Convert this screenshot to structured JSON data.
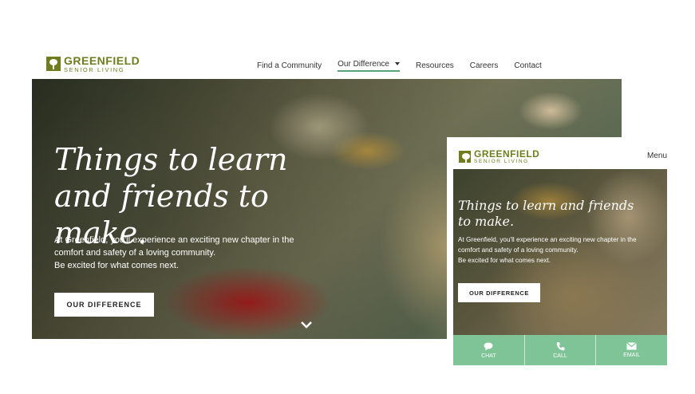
{
  "brand": {
    "name": "GREENFIELD",
    "tagline": "SENIOR LIVING",
    "color": "#6f7d1e"
  },
  "desktop": {
    "nav": [
      {
        "label": "Find a Community"
      },
      {
        "label": "Our Difference",
        "active": true,
        "has_dropdown": true
      },
      {
        "label": "Resources"
      },
      {
        "label": "Careers"
      },
      {
        "label": "Contact"
      }
    ],
    "hero": {
      "title": "Things to learn and friends to make.",
      "body_lines": [
        "At Greenfield, you'll experience an exciting new chapter in the",
        "comfort and safety of a loving community.",
        "Be excited for what comes next."
      ],
      "button_label": "OUR DIFFERENCE"
    }
  },
  "mobile": {
    "menu_label": "Menu",
    "hero": {
      "title": "Things to learn and friends to make.",
      "body_lines": [
        "At Greenfield, you'll experience an exciting new chapter in the",
        "comfort and safety of a loving community.",
        "Be excited for what comes next."
      ],
      "button_label": "OUR DIFFERENCE"
    },
    "action_bar": [
      {
        "label": "CHAT",
        "icon": "chat-icon"
      },
      {
        "label": "CALL",
        "icon": "phone-icon"
      },
      {
        "label": "EMAIL",
        "icon": "email-icon"
      }
    ],
    "action_bar_color": "#7fc497"
  },
  "accent_underline_color": "#5aa47a"
}
